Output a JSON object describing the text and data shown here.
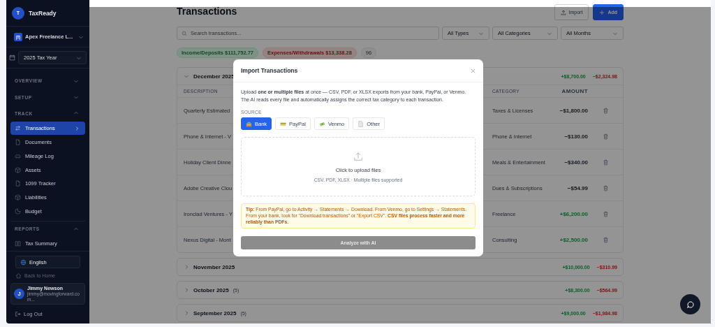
{
  "sidebar": {
    "logo_letter": "T",
    "app_name": "TaxReady",
    "business": "Apex Freelance L...",
    "tax_year": "2025 Tax Year",
    "sections": [
      {
        "label": "OVERVIEW",
        "expanded": false
      },
      {
        "label": "SETUP",
        "expanded": false
      },
      {
        "label": "TRACK",
        "expanded": true,
        "items": [
          {
            "label": "Transactions",
            "selected": true
          },
          {
            "label": "Documents",
            "selected": false
          },
          {
            "label": "Mileage Log",
            "selected": false
          },
          {
            "label": "Assets",
            "selected": false
          },
          {
            "label": "1099 Tracker",
            "selected": false
          },
          {
            "label": "Liabilities",
            "selected": false
          },
          {
            "label": "Budget",
            "selected": false
          }
        ]
      },
      {
        "label": "REPORTS",
        "expanded": true,
        "items": [
          {
            "label": "Tax Summary",
            "selected": false
          }
        ]
      }
    ],
    "language": "English",
    "back_link": "Back to Home",
    "user": {
      "initial": "J",
      "name": "Jimmy Newson",
      "email": "jimmy@movingforward.com..."
    },
    "logout": "Log Out"
  },
  "main": {
    "title": "Transactions",
    "import_button": "Import",
    "add_button": "Add",
    "search": {
      "placeholder": "Search transactions..."
    },
    "filters": [
      "All Types",
      "All Categories",
      "All Months"
    ],
    "badges": [
      {
        "kind": "income",
        "text": "Income/Deposits $111,752.77"
      },
      {
        "kind": "expense",
        "text": "Expenses/Withdrawals $13,338.28"
      },
      {
        "kind": "count",
        "text": "96"
      }
    ],
    "groups": [
      {
        "month": "December 2025",
        "expanded": true,
        "income": "+$8,700.00",
        "expense": "−$2,324.98",
        "columns": [
          "DESCRIPTION",
          "CATEGORY",
          "AMOUNT"
        ],
        "rows": [
          {
            "description": "Quarterly Estimated",
            "category": "Taxes & Licenses",
            "amount": "−$1,800.00",
            "kind": "expense"
          },
          {
            "description": "Phone & Internet - V",
            "category": "Phone & Internet",
            "amount": "−$130.00",
            "kind": "expense"
          },
          {
            "description": "Holiday Client Dinne",
            "category": "Meals & Entertainment",
            "amount": "−$340.00",
            "kind": "expense"
          },
          {
            "description": "Adobe Creative Clou",
            "category": "Dues & Subscriptions",
            "amount": "−$54.99",
            "kind": "expense"
          },
          {
            "description": "Ironclad Ventures - Y",
            "category": "Freelance",
            "amount": "+$6,200.00",
            "kind": "income"
          },
          {
            "description": "Nexus Digital - Mont",
            "category": "Consulting",
            "amount": "+$2,500.00",
            "kind": "income"
          }
        ]
      },
      {
        "month": "November 2025",
        "expanded": false,
        "income": "+$10,000.00",
        "expense": "−$310.99"
      },
      {
        "month": "October 2025",
        "count": "(5)",
        "expanded": false,
        "income": "+$8,300.00",
        "expense": "−$564.99"
      },
      {
        "month": "September 2025",
        "count": "(5)",
        "expanded": false,
        "income": "+$9,000.00",
        "expense": "−$1,984.98"
      }
    ]
  },
  "modal": {
    "title": "Import Transactions",
    "intro": "Upload **one or multiple files** at once — CSV, PDF, or XLSX exports from your bank, PayPal, or Venmo. The AI reads every file and automatically assigns the correct tax category to each transaction.",
    "source_label": "SOURCE",
    "sources": [
      {
        "label": "Bank",
        "selected": true
      },
      {
        "label": "PayPal",
        "selected": false
      },
      {
        "label": "Venmo",
        "selected": false
      },
      {
        "label": "Other",
        "selected": false
      }
    ],
    "upload_title": "Click to upload files",
    "upload_hint": "CSV, PDF, XLSX · Multiple files supported",
    "tip": "**Tip:** From PayPal, go to Activity → Statements → Download. From Venmo, go to Settings → Statements. From your bank, look for \"Download transactions\" or \"Export CSV\". **CSV files process faster and more reliably than PDFs.**",
    "analyze_button": {
      "label": "Analyze with AI",
      "disabled": true
    }
  }
}
